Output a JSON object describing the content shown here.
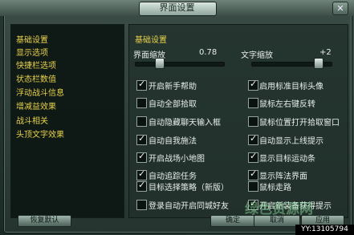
{
  "window": {
    "title": "界面设置",
    "close_icon": "close-icon"
  },
  "colors": {
    "active_nav": "#e8d24a",
    "nav": "#e8d24a",
    "section": "#e8d24a"
  },
  "sidebar": {
    "items": [
      {
        "label": "基础设置",
        "active": true
      },
      {
        "label": "显示选项"
      },
      {
        "label": "快捷栏选项"
      },
      {
        "label": "状态栏数值"
      },
      {
        "label": "浮动战斗信息"
      },
      {
        "label": "增减益效果"
      },
      {
        "label": "战斗相关"
      },
      {
        "label": "头顶文字效果"
      }
    ]
  },
  "main": {
    "section_title": "基础设置",
    "sliders": [
      {
        "label": "界面缩放",
        "value": "0.78",
        "level": 0.27
      },
      {
        "label": "文字缩放",
        "value": "+2",
        "level": 0.84
      }
    ],
    "options_left": [
      {
        "label": "开启新手帮助",
        "checked": true
      },
      {
        "label": "自动全部拾取",
        "checked": false
      },
      {
        "label": "自动隐藏聊天输入框",
        "checked": false
      },
      {
        "label": "自动自我施法",
        "checked": true
      },
      {
        "label": "开启战场小地图",
        "checked": true
      },
      {
        "label": "自动追踪任务",
        "checked": true
      },
      {
        "label": "目标选择策略（新版）",
        "checked": true
      },
      {
        "label": "登录自动开启同城好友",
        "checked": false
      }
    ],
    "options_right": [
      {
        "label": "启用标准目标头像",
        "checked": true
      },
      {
        "label": "鼠标左右键反转",
        "checked": false
      },
      {
        "label": "鼠标位置打开拾取窗口",
        "checked": false
      },
      {
        "label": "自动显示上线提示",
        "checked": true
      },
      {
        "label": "显示目标运动条",
        "checked": true
      },
      {
        "label": "显示阵法界面",
        "checked": true
      },
      {
        "label": "鼠标走路",
        "checked": false
      },
      {
        "label": "开启新装备获得提示",
        "checked": true
      }
    ]
  },
  "buttons": {
    "reset": "恢复默认",
    "ok": "确定",
    "cancel": "取消",
    "apply": "应用"
  },
  "watermark": {
    "logo": "绿色资源网",
    "text": "YY:13105794"
  }
}
